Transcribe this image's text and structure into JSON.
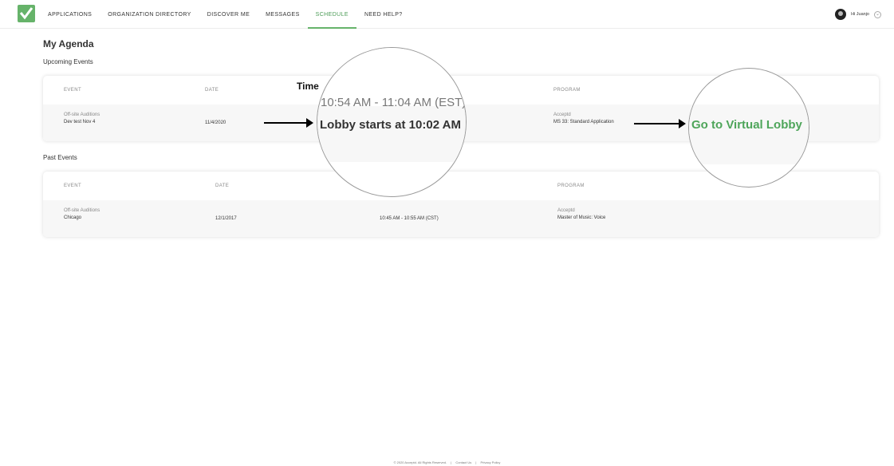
{
  "nav": {
    "items": [
      {
        "label": "APPLICATIONS",
        "active": false
      },
      {
        "label": "ORGANIZATION DIRECTORY",
        "active": false
      },
      {
        "label": "DISCOVER ME",
        "active": false
      },
      {
        "label": "MESSAGES",
        "active": false
      },
      {
        "label": "SCHEDULE",
        "active": true
      },
      {
        "label": "NEED HELP?",
        "active": false
      }
    ],
    "user_greeting": "Hi Juanjo"
  },
  "page": {
    "title": "My Agenda",
    "upcoming_title": "Upcoming Events",
    "past_title": "Past Events"
  },
  "columns": {
    "event": "EVENT",
    "date": "DATE",
    "program": "PROGRAM"
  },
  "upcoming": {
    "event_type": "Off-site Auditions",
    "event_name": "Dev test Nov 4",
    "date": "11/4/2020",
    "program_org": "Acceptd",
    "program_name": "MS 33: Standard Application"
  },
  "past": {
    "event_type": "Off-site Auditions",
    "event_name": "Chicago",
    "date": "12/1/2017",
    "time": "10:45 AM - 10:55 AM (CST)",
    "program_org": "Acceptd",
    "program_name": "Master of Music: Voice"
  },
  "annotation": {
    "time_label": "Time",
    "mag_time": "10:54 AM - 11:04 AM (EST)",
    "mag_lobby_start": "Lobby starts at 10:02 AM",
    "mag_lobby_link": "Go to Virtual Lobby"
  },
  "footer": {
    "copyright": "© 2020 Acceptd. All Rights Reserved.",
    "sep": "|",
    "contact": "Contact Us",
    "privacy": "Privacy Policy"
  },
  "colors": {
    "accent": "#66b36a",
    "link_green": "#4ea55a"
  }
}
